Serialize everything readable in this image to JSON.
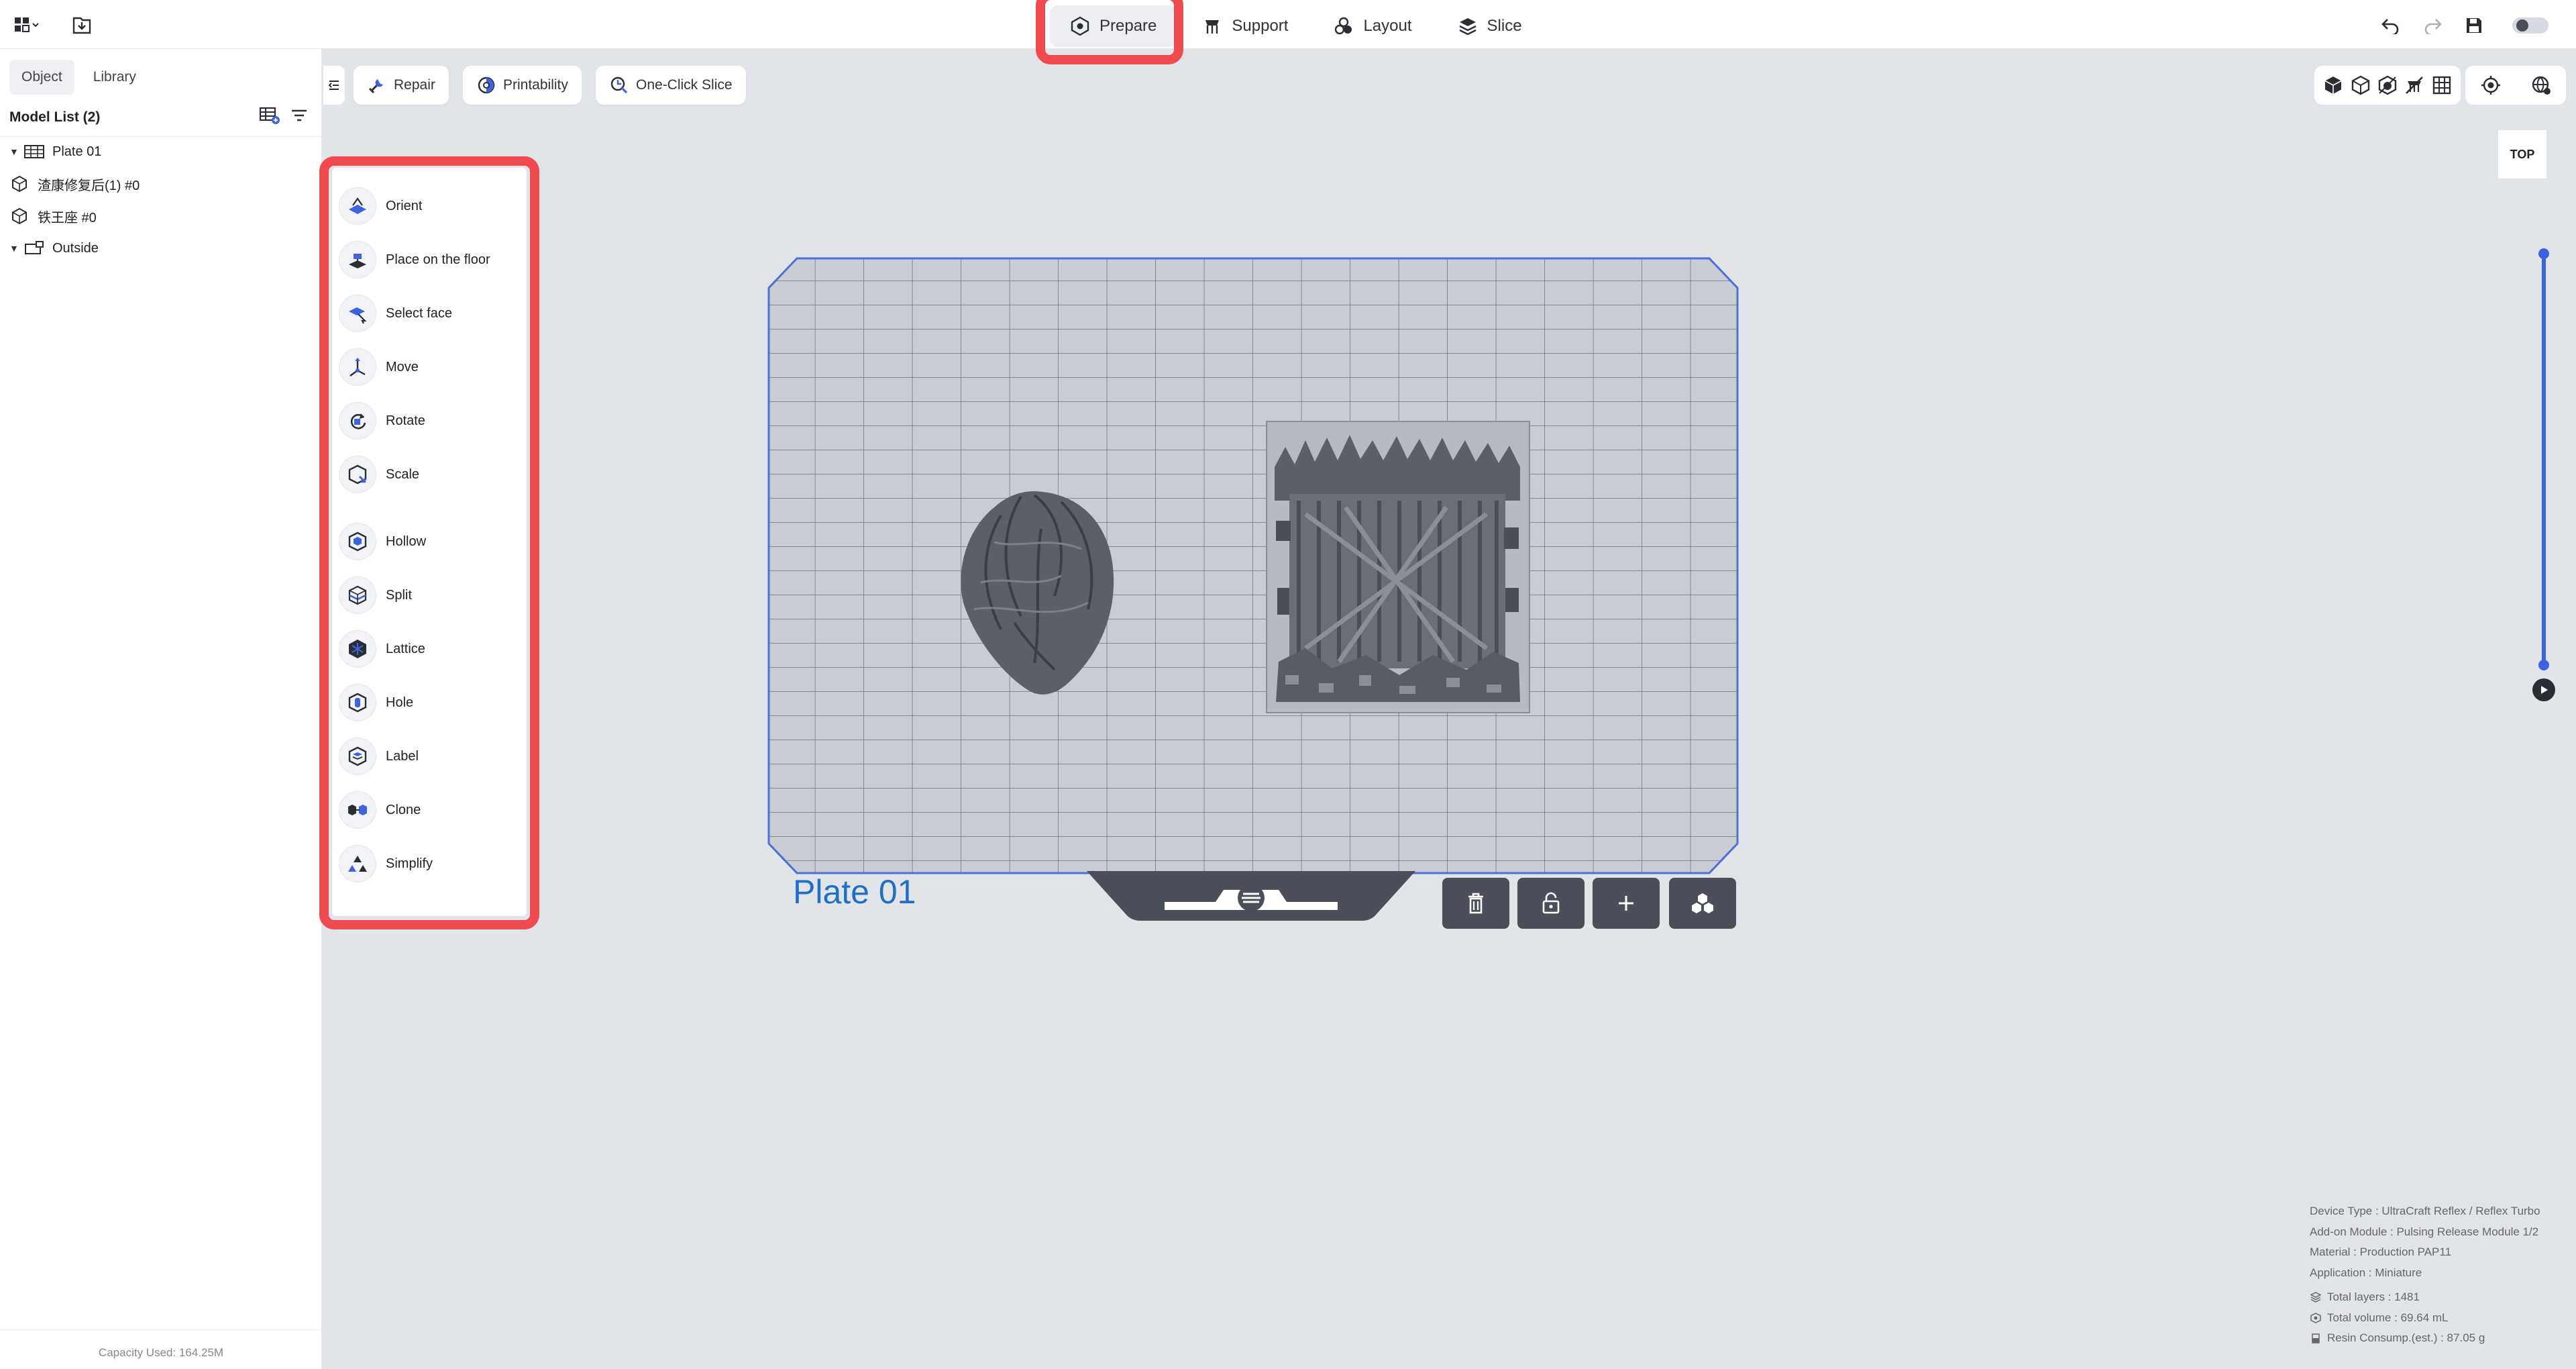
{
  "topbar": {
    "tabs": [
      {
        "label": "Prepare",
        "active": true
      },
      {
        "label": "Support",
        "active": false
      },
      {
        "label": "Layout",
        "active": false
      },
      {
        "label": "Slice",
        "active": false
      }
    ]
  },
  "left_panel": {
    "tabs": [
      "Object",
      "Library"
    ],
    "model_list_title": "Model List (2)",
    "tree": [
      {
        "label": "Plate 01",
        "kind": "plate",
        "expanded": true
      },
      {
        "label": "渣康修复后(1) #0",
        "kind": "model"
      },
      {
        "label": "铁王座 #0",
        "kind": "model"
      },
      {
        "label": "Outside",
        "kind": "outside",
        "expanded": true
      }
    ],
    "capacity": "Capacity Used: 164.25M"
  },
  "subtoolbar": {
    "repair": "Repair",
    "printability": "Printability",
    "one_click_slice": "One-Click Slice"
  },
  "tools": [
    {
      "label": "Orient",
      "icon": "orient-icon"
    },
    {
      "label": "Place on the floor",
      "icon": "floor-icon"
    },
    {
      "label": "Select face",
      "icon": "select-face-icon"
    },
    {
      "label": "Move",
      "icon": "move-icon"
    },
    {
      "label": "Rotate",
      "icon": "rotate-icon"
    },
    {
      "label": "Scale",
      "icon": "scale-icon"
    },
    {
      "label": "Hollow",
      "icon": "hollow-icon"
    },
    {
      "label": "Split",
      "icon": "split-icon"
    },
    {
      "label": "Lattice",
      "icon": "lattice-icon"
    },
    {
      "label": "Hole",
      "icon": "hole-icon"
    },
    {
      "label": "Label",
      "icon": "label-icon"
    },
    {
      "label": "Clone",
      "icon": "clone-icon"
    },
    {
      "label": "Simplify",
      "icon": "simplify-icon"
    }
  ],
  "view": {
    "orientation_label": "TOP"
  },
  "plate": {
    "name": "Plate 01"
  },
  "info": {
    "device_type": "Device Type : UltraCraft Reflex / Reflex Turbo",
    "addon_module": "Add-on Module : Pulsing Release Module 1/2",
    "material": "Material : Production PAP11",
    "application": "Application : Miniature",
    "total_layers": "Total layers : 1481",
    "total_volume": "Total volume : 69.64 mL",
    "resin_consumption": "Resin Consump.(est.) : 87.05 g"
  },
  "colors": {
    "accent_blue": "#3d63e0",
    "highlight_red": "#f0494e",
    "plate_title": "#1f6fc6"
  }
}
